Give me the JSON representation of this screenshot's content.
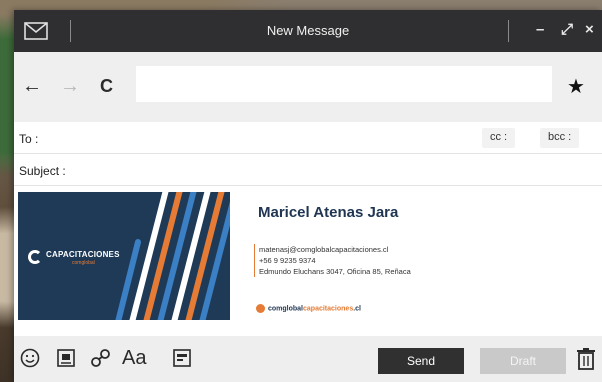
{
  "window": {
    "title": "New Message",
    "controls": {
      "minimize": "–",
      "maximize": "⤢",
      "close": "×"
    }
  },
  "nav": {
    "back_icon": "←",
    "forward_icon": "→",
    "reload_icon": "C",
    "url_value": "",
    "star_icon": "★"
  },
  "compose": {
    "to_label": "To :",
    "cc_label": "cc :",
    "bcc_label": "bcc :",
    "subject_label": "Subject :"
  },
  "signature": {
    "logo_text": "CAPACITACIONES",
    "logo_sub": "comglobal",
    "name": "Maricel Atenas Jara",
    "email": "matenasj@comglobalcapacitaciones.cl",
    "phone": "+56 9 9235 9374",
    "address": "Edmundo Eluchans 3047, Oficina 85, Reñaca",
    "web_brand": "comglobal",
    "web_accent": "capacitaciones",
    "web_tld": ".cl",
    "accent_color": "#e57b34",
    "navy_color": "#1e3a57"
  },
  "toolbar": {
    "emoji_icon": "smiley-icon",
    "image_icon": "image-icon",
    "link_icon": "link-icon",
    "format_label": "Aa",
    "template_icon": "template-icon",
    "send_label": "Send",
    "draft_label": "Draft",
    "trash_icon": "trash-icon"
  }
}
